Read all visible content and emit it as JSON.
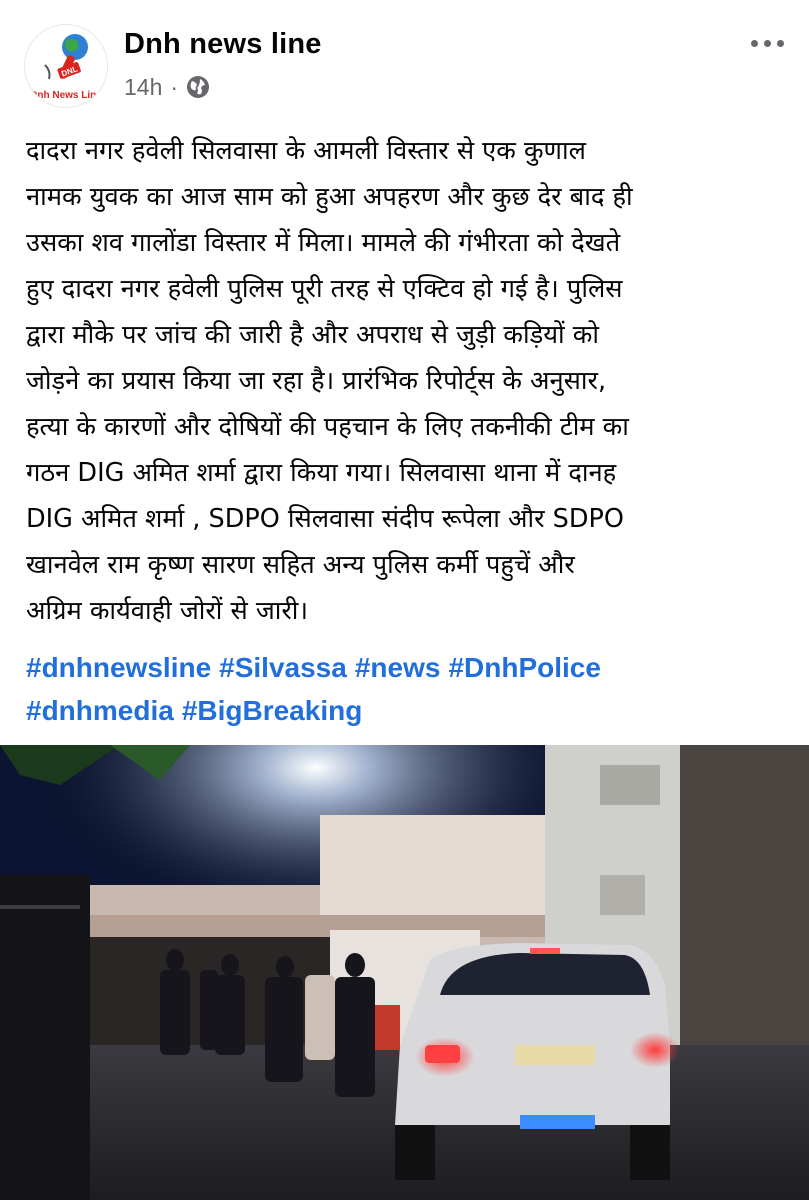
{
  "post": {
    "page_name": "Dnh news line",
    "timestamp": "14h",
    "separator": "·",
    "privacy_icon": "globe-icon",
    "more_icon": "more-horizontal-icon",
    "avatar": {
      "logo_text": "DNL",
      "caption": "Dnh News Line"
    },
    "body_lines": [
      "दादरा नगर हवेली सिलवासा के आमली विस्तार से एक कुणाल",
      "नामक युवक का आज साम को हुआ अपहरण और कुछ देर बाद ही",
      "उसका शव गालोंडा विस्तार में मिला। मामले की गंभीरता को देखते",
      "हुए दादरा नगर हवेली पुलिस पूरी तरह से एक्टिव हो गई है। पुलिस",
      "द्वारा मौके पर जांच की जारी है और अपराध से जुड़ी कड़ियों को",
      "जोड़ने का प्रयास किया जा रहा है। प्रारंभिक रिपोर्ट्स के अनुसार,",
      "हत्या के कारणों और दोषियों की पहचान के लिए तकनीकी टीम का",
      "गठन DIG अमित शर्मा द्वारा किया गया। सिलवासा थाना में दानह",
      "DIG अमित शर्मा , SDPO सिलवासा संदीप रूपेला और SDPO",
      "खानवेल राम कृष्ण सारण सहित अन्य पुलिस कर्मी पहुचें और",
      "अग्रिम कार्यवाही जोरों से जारी।"
    ],
    "hashtags": [
      "#dnhnewsline",
      "#Silvassa",
      "#news",
      "#DnhPolice",
      "#dnhmedia",
      "#BigBreaking"
    ]
  },
  "colors": {
    "hashtag": "#216fdb",
    "meta_text": "#65676b",
    "body_text": "#050505"
  }
}
